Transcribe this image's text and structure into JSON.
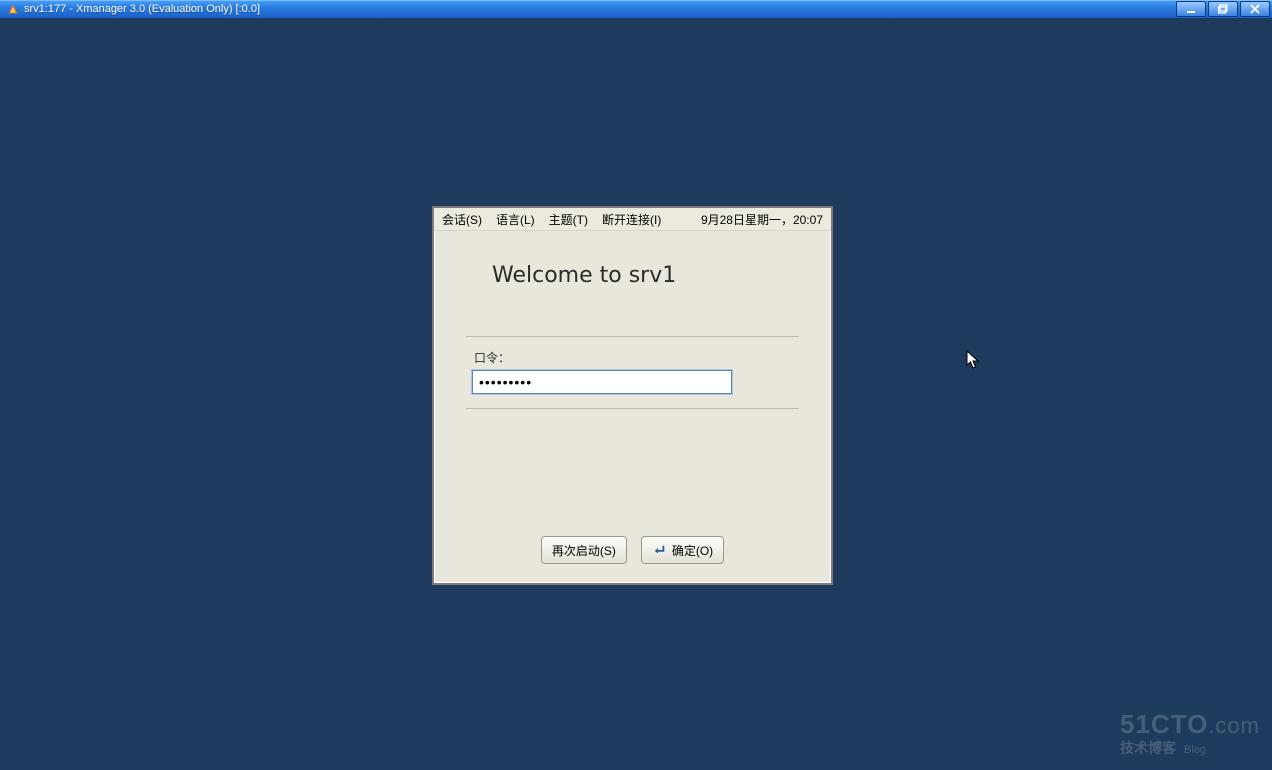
{
  "window": {
    "title": "srv1:177 - Xmanager 3.0 (Evaluation Only) [:0.0]"
  },
  "menubar": {
    "session": "会话(S)",
    "language": "语言(L)",
    "theme": "主题(T)",
    "disconnect": "断开连接(I)",
    "datetime": "9月28日星期一，20:07"
  },
  "login": {
    "welcome": "Welcome to srv1",
    "password_label": "口令：",
    "password_value": "•••••••••",
    "restart_button": "再次启动(S)",
    "ok_button": "确定(O)"
  },
  "watermark": {
    "brand": "51CTO",
    "suffix": ".com",
    "sub": "技术博客",
    "blog": "Blog"
  }
}
